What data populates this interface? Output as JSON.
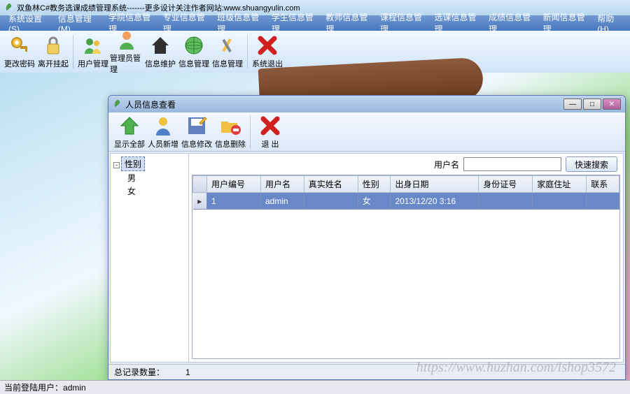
{
  "app_title": "双鱼林C#教务选课成绩管理系统-------更多设计关注作者网站:www.shuangyulin.com",
  "menu": [
    "系统设置(S)",
    "信息管理(M)",
    "学院信息管理",
    "专业信息管理",
    "班级信息管理",
    "学生信息管理",
    "教师信息管理",
    "课程信息管理",
    "选课信息管理",
    "成绩信息管理",
    "新闻信息管理",
    "帮助(H)"
  ],
  "toolbar": [
    {
      "label": "更改密码"
    },
    {
      "label": "离开挂起"
    },
    {
      "label": "用户管理"
    },
    {
      "label": "管理员管理"
    },
    {
      "label": "信息维护"
    },
    {
      "label": "信息管理"
    },
    {
      "label": "信息管理"
    },
    {
      "label": "系统退出"
    }
  ],
  "status_bar": {
    "label": "当前登陆用户：",
    "user": "admin"
  },
  "dialog": {
    "title": "人员信息查看",
    "toolbar": [
      {
        "label": "显示全部"
      },
      {
        "label": "人员新增"
      },
      {
        "label": "信息修改"
      },
      {
        "label": "信息删除"
      },
      {
        "label": "退 出"
      }
    ],
    "tree": {
      "root": "性别",
      "children": [
        "男",
        "女"
      ]
    },
    "search": {
      "label": "用户名",
      "placeholder": "",
      "button": "快速搜索"
    },
    "grid": {
      "columns": [
        "用户编号",
        "用户名",
        "真实姓名",
        "性别",
        "出身日期",
        "身份证号",
        "家庭住址",
        "联系"
      ],
      "rows": [
        {
          "user_no": "1",
          "username": "admin",
          "realname": "",
          "gender": "女",
          "birth": "2013/12/20 3:16",
          "idcard": "",
          "address": "",
          "contact": ""
        }
      ]
    },
    "footer": {
      "label": "总记录数量：",
      "count": "1"
    }
  },
  "watermark": "https://www.huzhan.com/ishop3572"
}
